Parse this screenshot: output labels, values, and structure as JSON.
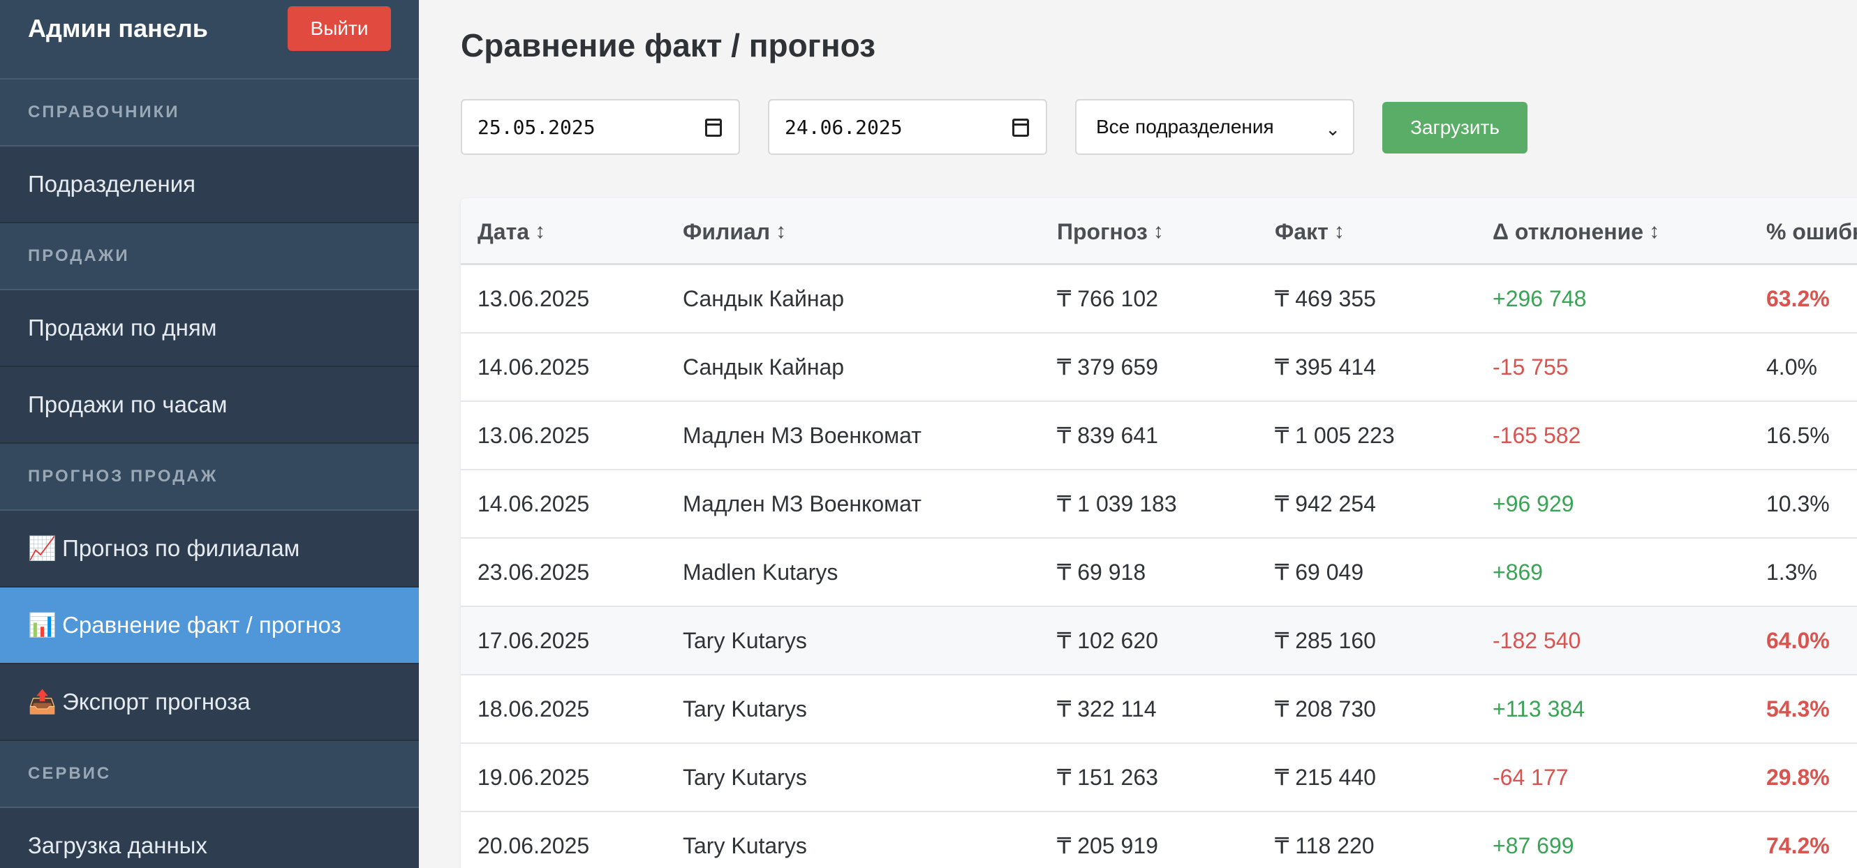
{
  "sidebar": {
    "title": "Админ панель",
    "logout_label": "Выйти",
    "sections": [
      {
        "label": "СПРАВОЧНИКИ"
      },
      {
        "label": "ПРОДАЖИ"
      },
      {
        "label": "ПРОГНОЗ ПРОДАЖ"
      },
      {
        "label": "СЕРВИС"
      }
    ],
    "items": [
      {
        "label": "Подразделения"
      },
      {
        "label": "Продажи по дням"
      },
      {
        "label": "Продажи по часам"
      },
      {
        "icon": "📈",
        "label": "Прогноз по филиалам"
      },
      {
        "icon": "📊",
        "label": "Сравнение факт / прогноз"
      },
      {
        "icon": "📤",
        "label": "Экспорт прогноза"
      },
      {
        "label": "Загрузка данных"
      }
    ],
    "active_item": "Сравнение факт / прогноз"
  },
  "main": {
    "title": "Сравнение факт / прогноз",
    "filters": {
      "date_from": "25.05.2025",
      "date_to": "24.06.2025",
      "division": "Все подразделения",
      "load_label": "Загрузить"
    },
    "table": {
      "sort_glyph": "↕",
      "columns": [
        "Дата",
        "Филиал",
        "Прогноз",
        "Факт",
        "Δ отклонение",
        "% ошибки"
      ],
      "rows": [
        {
          "date": "13.06.2025",
          "branch": "Сандык Кайнар",
          "forecast": "₸ 766 102",
          "fact": "₸ 469 355",
          "delta": "+296 748",
          "error": "63.2%",
          "delta_sign": "pos",
          "error_level": "high"
        },
        {
          "date": "14.06.2025",
          "branch": "Сандык Кайнар",
          "forecast": "₸ 379 659",
          "fact": "₸ 395 414",
          "delta": "-15 755",
          "error": "4.0%",
          "delta_sign": "neg",
          "error_level": "low"
        },
        {
          "date": "13.06.2025",
          "branch": "Мадлен МЗ Военкомат",
          "forecast": "₸ 839 641",
          "fact": "₸ 1 005 223",
          "delta": "-165 582",
          "error": "16.5%",
          "delta_sign": "neg",
          "error_level": "low"
        },
        {
          "date": "14.06.2025",
          "branch": "Мадлен МЗ Военкомат",
          "forecast": "₸ 1 039 183",
          "fact": "₸ 942 254",
          "delta": "+96 929",
          "error": "10.3%",
          "delta_sign": "pos",
          "error_level": "low"
        },
        {
          "date": "23.06.2025",
          "branch": "Madlen Kutarys",
          "forecast": "₸ 69 918",
          "fact": "₸ 69 049",
          "delta": "+869",
          "error": "1.3%",
          "delta_sign": "pos",
          "error_level": "low"
        },
        {
          "date": "17.06.2025",
          "branch": "Tary Kutarys",
          "forecast": "₸ 102 620",
          "fact": "₸ 285 160",
          "delta": "-182 540",
          "error": "64.0%",
          "delta_sign": "neg",
          "error_level": "high"
        },
        {
          "date": "18.06.2025",
          "branch": "Tary Kutarys",
          "forecast": "₸ 322 114",
          "fact": "₸ 208 730",
          "delta": "+113 384",
          "error": "54.3%",
          "delta_sign": "pos",
          "error_level": "high"
        },
        {
          "date": "19.06.2025",
          "branch": "Tary Kutarys",
          "forecast": "₸ 151 263",
          "fact": "₸ 215 440",
          "delta": "-64 177",
          "error": "29.8%",
          "delta_sign": "neg",
          "error_level": "high"
        },
        {
          "date": "20.06.2025",
          "branch": "Tary Kutarys",
          "forecast": "₸ 205 919",
          "fact": "₸ 118 220",
          "delta": "+87 699",
          "error": "74.2%",
          "delta_sign": "pos",
          "error_level": "high"
        }
      ]
    }
  },
  "colors": {
    "sidebar_bg": "#2e3e50",
    "active": "#4f97d9",
    "danger": "#e14b3f",
    "success": "#5aad66",
    "positive_text": "#3aa356",
    "negative_text": "#d9534f"
  }
}
